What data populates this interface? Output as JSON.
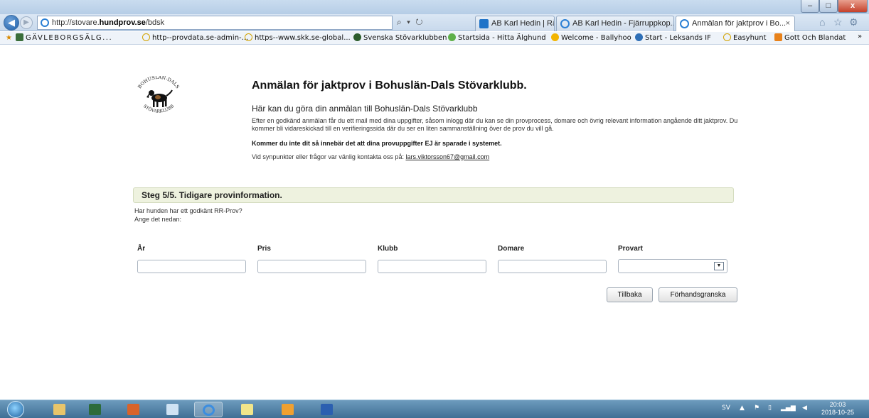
{
  "browser": {
    "address_prefix": "http://stovare.",
    "address_domain": "hundprov.se",
    "address_path": "/bdsk",
    "address_controls": "⌕ ▾ ↻",
    "tabs": [
      {
        "label": "AB Karl Hedin | Råvara"
      },
      {
        "label": "AB Karl Hedin - Fjärruppkop..."
      },
      {
        "label": "Anmälan för jaktprov i Bo...",
        "close": "×"
      }
    ],
    "window_controls": {
      "min": "–",
      "max": "□",
      "close": "x"
    },
    "favorites": [
      "GÄVLEBORGSÄLG...",
      "http--provdata.se-admin-...",
      "https--www.skk.se-global...",
      "Svenska Stövarklubben",
      "Startsida - Hitta Älghund",
      "Welcome - Ballyhoo",
      "Start - Leksands IF",
      "Easyhunt",
      "Gott Och Blandat"
    ],
    "favbar_more": "»"
  },
  "page": {
    "logo_top": "BOHUSLÄN-DALS",
    "logo_bottom": "STÖVARKLUBB",
    "heading": "Anmälan för jaktprov i Bohuslän-Dals Stövarklubb.",
    "subheading": "Här kan du göra din anmälan till Bohuslän-Dals Stövarklubb",
    "paragraph": "Efter en godkänd anmälan får du ett mail med dina uppgifter, såsom inlogg där du kan se din provprocess, domare och övrig relevant information angående ditt jaktprov. Du kommer bli vidareskickad till en verifieringssida där du ser en liten sammanställning över de prov du vill gå.",
    "bold_note": "Kommer du inte dit så innebär det att dina provuppgifter EJ är sparade i systemet.",
    "contact_text": "Vid synpunkter eller frågor var vänlig kontakta oss på:",
    "contact_email": "lars.viktorsson67@gmail.com",
    "step_title": "Steg 5/5. Tidigare provinformation.",
    "question_line1": "Har hunden har ett godkänt RR-Prov?",
    "question_line2": "Ange det nedan:",
    "fields": {
      "year_label": "År",
      "price_label": "Pris",
      "club_label": "Klubb",
      "judge_label": "Domare",
      "type_label": "Provart"
    },
    "buttons": {
      "back": "Tillbaka",
      "preview": "Förhandsgranska"
    }
  },
  "taskbar": {
    "language": "SV",
    "time": "20:03",
    "date": "2018-10-25"
  }
}
